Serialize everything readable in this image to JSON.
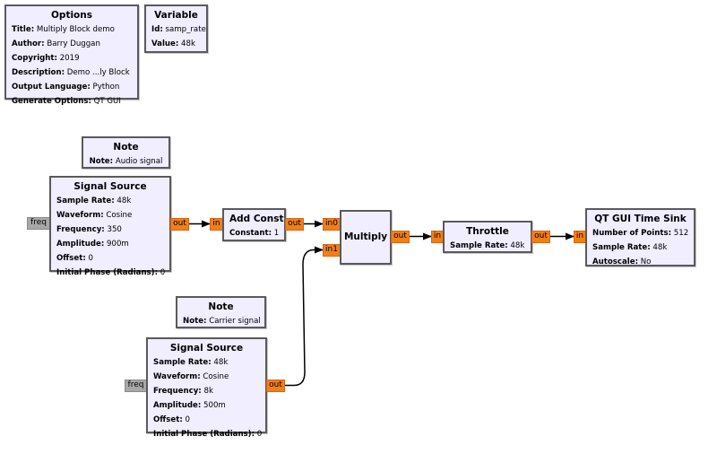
{
  "blocks": {
    "options": {
      "title": "Options",
      "params": [
        {
          "key": "Title:",
          "value": "Multiply Block demo"
        },
        {
          "key": "Author:",
          "value": "Barry Duggan"
        },
        {
          "key": "Copyright:",
          "value": "2019"
        },
        {
          "key": "Description:",
          "value": "Demo ...ly Block"
        },
        {
          "key": "Output Language:",
          "value": "Python"
        },
        {
          "key": "Generate Options:",
          "value": "QT GUI"
        }
      ]
    },
    "variable": {
      "title": "Variable",
      "params": [
        {
          "key": "Id:",
          "value": "samp_rate"
        },
        {
          "key": "Value:",
          "value": "48k"
        }
      ]
    },
    "note_audio": {
      "title": "Note",
      "params": [
        {
          "key": "Note:",
          "value": "Audio signal"
        }
      ]
    },
    "note_carrier": {
      "title": "Note",
      "params": [
        {
          "key": "Note:",
          "value": "Carrier signal"
        }
      ]
    },
    "signal_source_1": {
      "title": "Signal Source",
      "params": [
        {
          "key": "Sample Rate:",
          "value": "48k"
        },
        {
          "key": "Waveform:",
          "value": "Cosine"
        },
        {
          "key": "Frequency:",
          "value": "350"
        },
        {
          "key": "Amplitude:",
          "value": "900m"
        },
        {
          "key": "Offset:",
          "value": "0"
        },
        {
          "key": "Initial Phase (Radians):",
          "value": "0"
        }
      ],
      "ports": {
        "in": "freq",
        "out": "out"
      }
    },
    "signal_source_2": {
      "title": "Signal Source",
      "params": [
        {
          "key": "Sample Rate:",
          "value": "48k"
        },
        {
          "key": "Waveform:",
          "value": "Cosine"
        },
        {
          "key": "Frequency:",
          "value": "8k"
        },
        {
          "key": "Amplitude:",
          "value": "500m"
        },
        {
          "key": "Offset:",
          "value": "0"
        },
        {
          "key": "Initial Phase (Radians):",
          "value": "0"
        }
      ],
      "ports": {
        "in": "freq",
        "out": "out"
      }
    },
    "add_const": {
      "title": "Add Const",
      "params": [
        {
          "key": "Constant:",
          "value": "1"
        }
      ],
      "ports": {
        "in": "in",
        "out": "out"
      }
    },
    "multiply": {
      "title": "Multiply",
      "ports": {
        "in0": "in0",
        "in1": "in1",
        "out": "out"
      }
    },
    "throttle": {
      "title": "Throttle",
      "params": [
        {
          "key": "Sample Rate:",
          "value": "48k"
        }
      ],
      "ports": {
        "in": "in",
        "out": "out"
      }
    },
    "qt_time_sink": {
      "title": "QT GUI Time Sink",
      "params": [
        {
          "key": "Number of Points:",
          "value": "512"
        },
        {
          "key": "Sample Rate:",
          "value": "48k"
        },
        {
          "key": "Autoscale:",
          "value": "No"
        }
      ],
      "ports": {
        "in": "in"
      }
    }
  },
  "connections": [
    {
      "from": "signal_source_1.out",
      "to": "add_const.in"
    },
    {
      "from": "add_const.out",
      "to": "multiply.in0"
    },
    {
      "from": "signal_source_2.out",
      "to": "multiply.in1"
    },
    {
      "from": "multiply.out",
      "to": "throttle.in"
    },
    {
      "from": "throttle.out",
      "to": "qt_time_sink.in"
    }
  ]
}
